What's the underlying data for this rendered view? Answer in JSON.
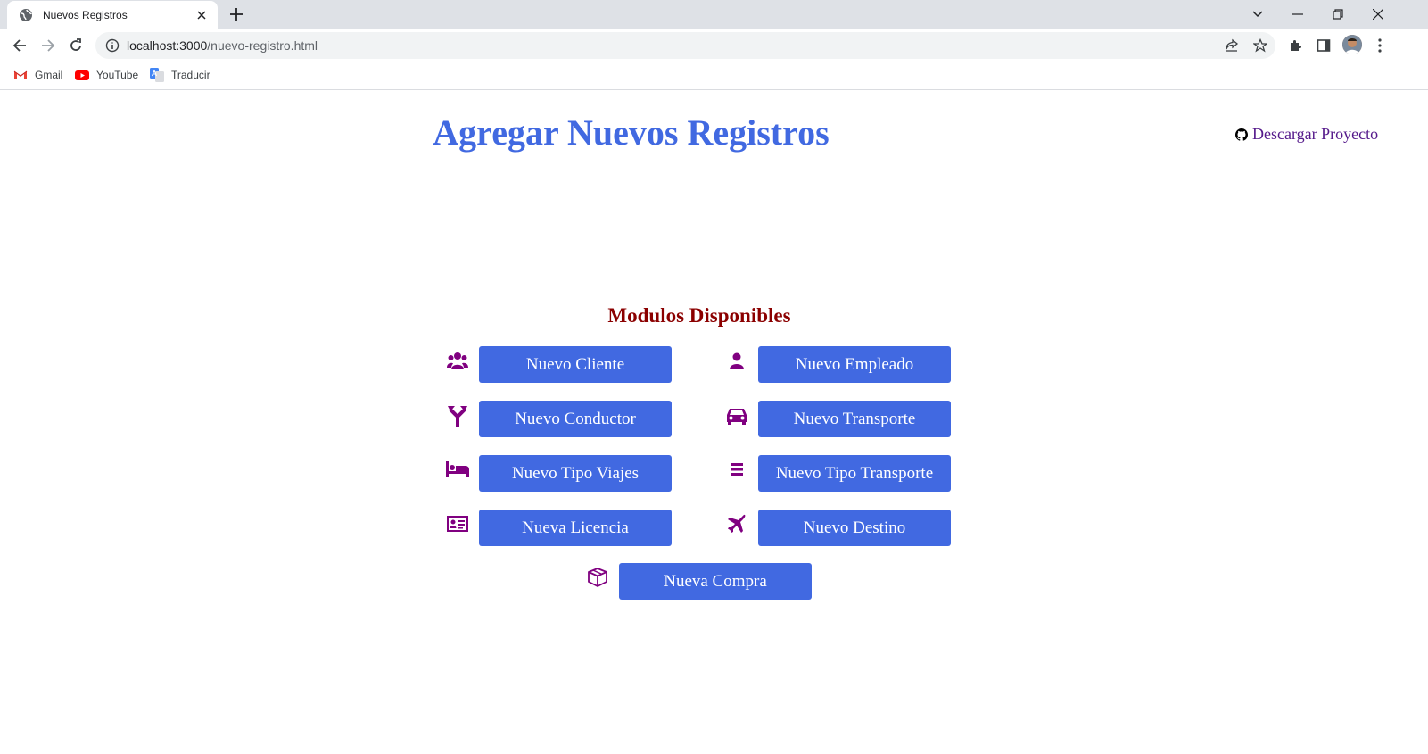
{
  "browser": {
    "tab_title": "Nuevos Registros",
    "url_host": "localhost:3000",
    "url_path": "/nuevo-registro.html",
    "bookmarks": [
      {
        "label": "Gmail",
        "icon": "gmail-icon"
      },
      {
        "label": "YouTube",
        "icon": "youtube-icon"
      },
      {
        "label": "Traducir",
        "icon": "translate-icon"
      }
    ]
  },
  "header": {
    "title": "Agregar Nuevos Registros",
    "download_link": "Descargar Proyecto",
    "download_icon": "github-icon"
  },
  "modules": {
    "heading": "Modulos Disponibles",
    "items": [
      {
        "label": "Nuevo Cliente",
        "icon": "users-icon"
      },
      {
        "label": "Nuevo Empleado",
        "icon": "user-icon"
      },
      {
        "label": "Nuevo Conductor",
        "icon": "road-fork-icon"
      },
      {
        "label": "Nuevo Transporte",
        "icon": "car-icon"
      },
      {
        "label": "Nuevo Tipo Viajes",
        "icon": "bed-icon"
      },
      {
        "label": "Nuevo Tipo Transporte",
        "icon": "list-icon"
      },
      {
        "label": "Nueva Licencia",
        "icon": "id-card-icon"
      },
      {
        "label": "Nuevo Destino",
        "icon": "plane-icon"
      },
      {
        "label": "Nueva Compra",
        "icon": "box-icon"
      }
    ]
  },
  "colors": {
    "title": "#4169e1",
    "button": "#4169e1",
    "heading": "#8b0000",
    "icon": "#800080",
    "link": "#551a8b"
  }
}
